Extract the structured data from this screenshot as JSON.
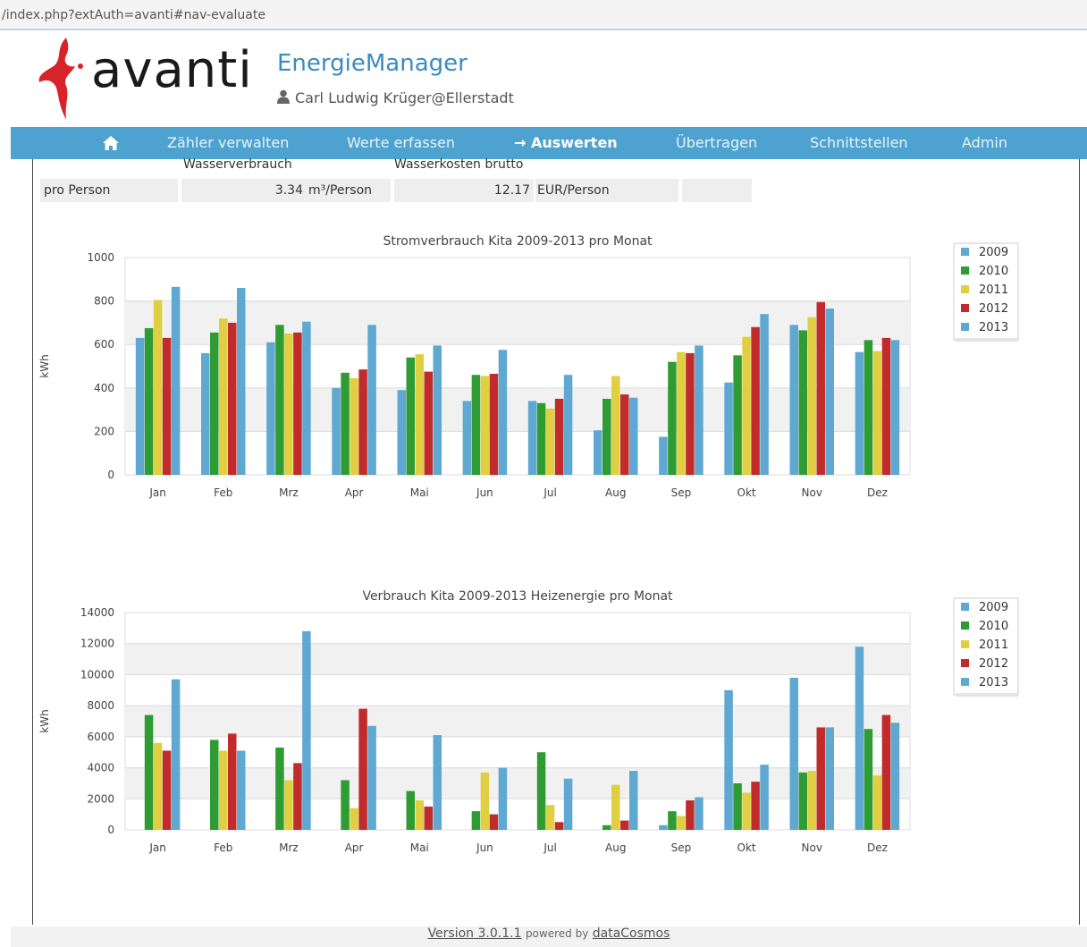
{
  "browser": {
    "url": "/index.php?extAuth=avanti#nav-evaluate"
  },
  "header": {
    "logo_text": "avanti",
    "app_title": "EnergieManager",
    "user": "Carl Ludwig Krüger@Ellerstadt"
  },
  "nav": {
    "items": [
      "Zähler verwalten",
      "Werte erfassen",
      "→ Auswerten",
      "Übertragen",
      "Schnittstellen",
      "Admin"
    ],
    "home_icon": "home-icon"
  },
  "stats": {
    "col1_header": "Wasserverbrauch",
    "col2_header": "Wasserkosten brutto",
    "row_label": "pro Person",
    "water_value": "3.34",
    "water_unit": "m³/Person",
    "cost_value": "12.17",
    "cost_unit": "EUR/Person"
  },
  "footer": {
    "version": "Version 3.0.1.1",
    "powered": "powered by",
    "vendor": "dataCosmos"
  },
  "colors": {
    "2009": "#5ea8d2",
    "2010": "#2e9c33",
    "2011": "#e0cf42",
    "2012": "#c12b2b",
    "2013": "#5ea8d2"
  },
  "chart_data": [
    {
      "type": "bar",
      "title": "Stromverbrauch Kita 2009-2013 pro Monat",
      "ylabel": "kWh",
      "ylim": [
        0,
        1000
      ],
      "yticks": [
        0,
        200,
        400,
        600,
        800,
        1000
      ],
      "legend": "top-right",
      "categories": [
        "Jan",
        "Feb",
        "Mrz",
        "Apr",
        "Mai",
        "Jun",
        "Jul",
        "Aug",
        "Sep",
        "Okt",
        "Nov",
        "Dez"
      ],
      "series": [
        {
          "name": "2009",
          "values": [
            630,
            560,
            610,
            400,
            390,
            340,
            340,
            205,
            175,
            425,
            690,
            565
          ]
        },
        {
          "name": "2010",
          "values": [
            675,
            655,
            690,
            470,
            540,
            460,
            330,
            350,
            520,
            550,
            665,
            620
          ]
        },
        {
          "name": "2011",
          "values": [
            805,
            720,
            650,
            445,
            555,
            455,
            305,
            455,
            565,
            635,
            725,
            570
          ]
        },
        {
          "name": "2012",
          "values": [
            630,
            700,
            655,
            485,
            475,
            465,
            350,
            370,
            560,
            680,
            795,
            630
          ]
        },
        {
          "name": "2013",
          "values": [
            865,
            860,
            705,
            690,
            595,
            575,
            460,
            355,
            595,
            740,
            765,
            620
          ]
        }
      ]
    },
    {
      "type": "bar",
      "title": "Verbrauch Kita 2009-2013 Heizenergie pro Monat",
      "ylabel": "kWh",
      "ylim": [
        0,
        14000
      ],
      "yticks": [
        0,
        2000,
        4000,
        6000,
        8000,
        10000,
        12000,
        14000
      ],
      "legend": "top-right",
      "categories": [
        "Jan",
        "Feb",
        "Mrz",
        "Apr",
        "Mai",
        "Jun",
        "Jul",
        "Aug",
        "Sep",
        "Okt",
        "Nov",
        "Dez"
      ],
      "series": [
        {
          "name": "2009",
          "values": [
            0,
            0,
            0,
            0,
            0,
            0,
            0,
            0,
            300,
            9000,
            9800,
            11800
          ]
        },
        {
          "name": "2010",
          "values": [
            7400,
            5800,
            5300,
            3200,
            2500,
            1200,
            5000,
            300,
            1200,
            3000,
            3700,
            6500
          ]
        },
        {
          "name": "2011",
          "values": [
            5600,
            5100,
            3200,
            1400,
            1900,
            3700,
            1600,
            2900,
            900,
            2400,
            3800,
            3500
          ]
        },
        {
          "name": "2012",
          "values": [
            5100,
            6200,
            4300,
            7800,
            1500,
            1000,
            500,
            600,
            1900,
            3100,
            6600,
            7400
          ]
        },
        {
          "name": "2013",
          "values": [
            9700,
            5100,
            12800,
            6700,
            6100,
            4000,
            3300,
            3800,
            2100,
            4200,
            6600,
            6900
          ]
        }
      ]
    }
  ]
}
